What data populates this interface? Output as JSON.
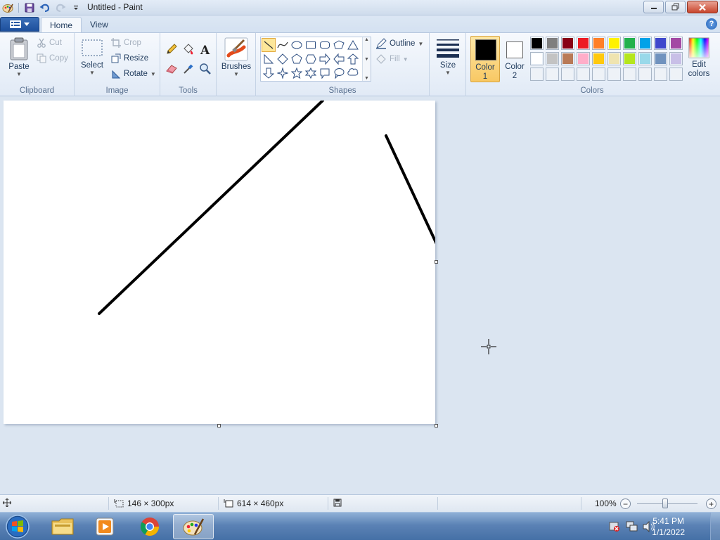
{
  "window": {
    "title": "Untitled - Paint"
  },
  "tabs": [
    {
      "label": "Home",
      "active": true
    },
    {
      "label": "View",
      "active": false
    }
  ],
  "ribbon": {
    "clipboard": {
      "label": "Clipboard",
      "paste": "Paste",
      "cut": "Cut",
      "copy": "Copy"
    },
    "image": {
      "label": "Image",
      "select": "Select",
      "crop": "Crop",
      "resize": "Resize",
      "rotate": "Rotate"
    },
    "tools": {
      "label": "Tools",
      "items": [
        "pencil-icon",
        "fill-bucket-icon",
        "text-icon",
        "eraser-icon",
        "color-picker-icon",
        "magnifier-icon"
      ]
    },
    "brushes": {
      "label": "Brushes"
    },
    "shapes": {
      "label": "Shapes",
      "outline": "Outline",
      "fill": "Fill",
      "items": [
        "line",
        "curve",
        "oval",
        "rectangle",
        "rounded-rectangle",
        "polygon",
        "triangle",
        "right-triangle",
        "diamond",
        "pentagon",
        "hexagon",
        "right-arrow",
        "left-arrow",
        "up-arrow",
        "down-arrow",
        "four-point-star",
        "five-point-star",
        "six-point-star",
        "rounded-callout",
        "oval-callout",
        "cloud-callout"
      ],
      "selected": "line"
    },
    "size": {
      "label": "Size"
    },
    "color1": {
      "label_line1": "Color",
      "label_line2": "1",
      "value": "#000000"
    },
    "color2": {
      "label_line1": "Color",
      "label_line2": "2",
      "value": "#ffffff"
    },
    "colors": {
      "label": "Colors",
      "row1": [
        "#000000",
        "#7f7f7f",
        "#880015",
        "#ed1c24",
        "#ff7f27",
        "#fff200",
        "#22b14c",
        "#00a2e8",
        "#3f48cc",
        "#a349a4"
      ],
      "row2": [
        "#ffffff",
        "#c3c3c3",
        "#b97a57",
        "#ffaec9",
        "#ffc90e",
        "#efe4b0",
        "#b5e61d",
        "#99d9ea",
        "#7092be",
        "#c8bfe7"
      ],
      "row3_count": 10
    },
    "edit_colors": {
      "label_line1": "Edit",
      "label_line2": "colors"
    }
  },
  "statusbar": {
    "selection_size": "146 × 300px",
    "canvas_size": "614 × 460px",
    "zoom": "100%",
    "zoom_level": 1.0
  },
  "taskbar": {
    "apps": [
      "windows-explorer",
      "media-player",
      "chrome",
      "paint"
    ],
    "active_app": "paint",
    "time": "5:41 PM",
    "date": "1/1/2022"
  }
}
